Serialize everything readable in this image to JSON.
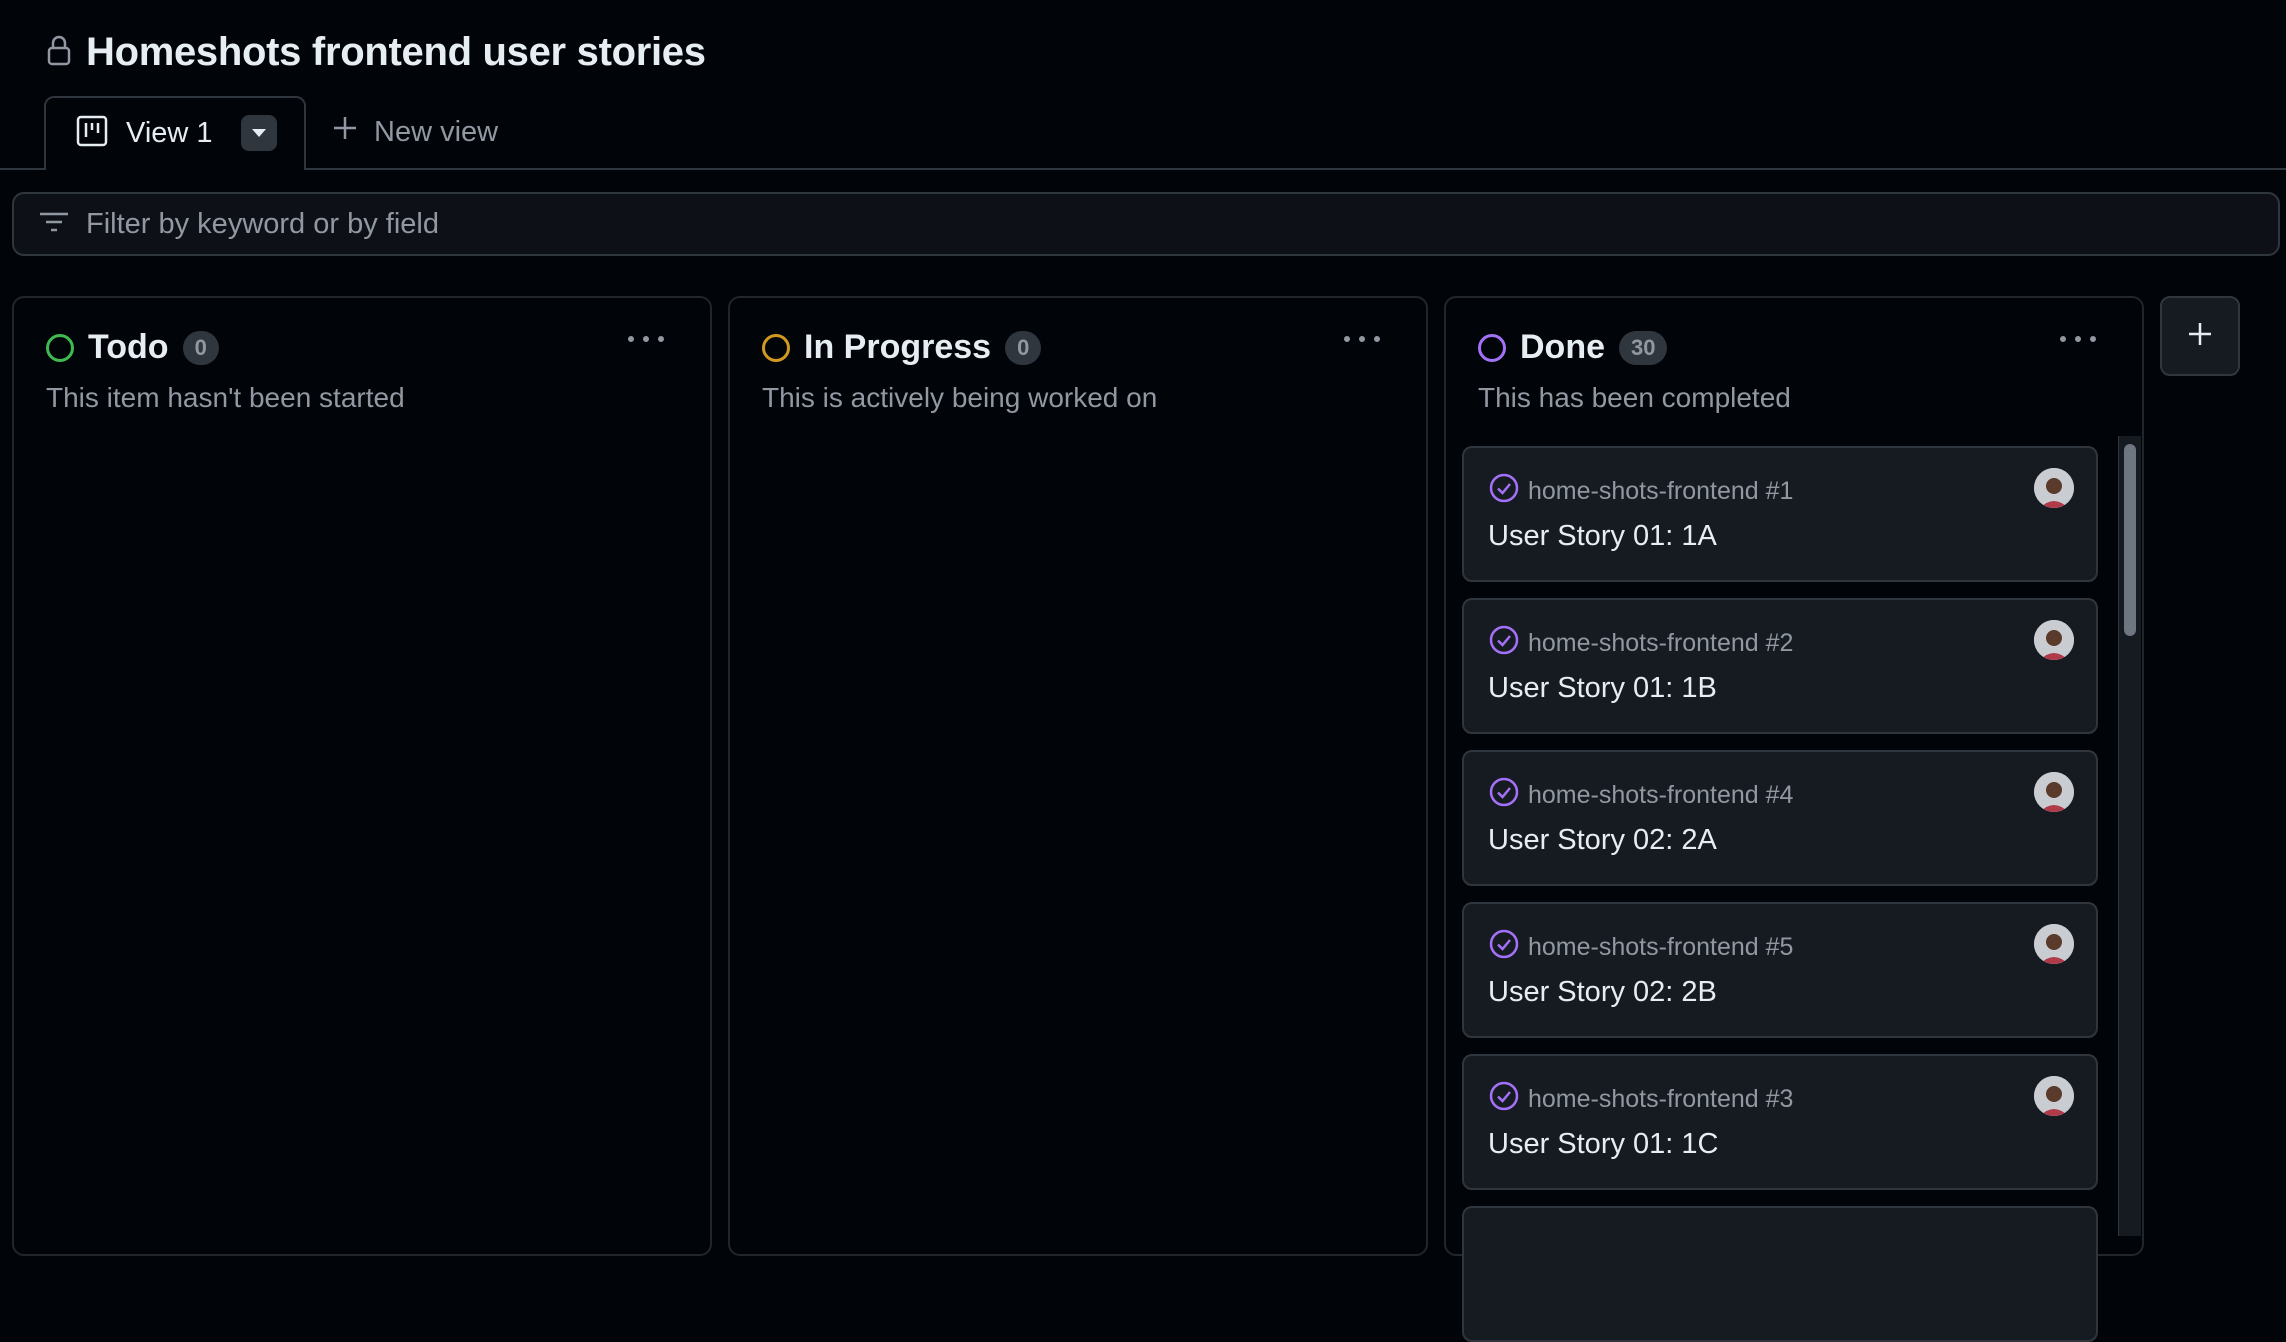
{
  "project": {
    "title": "Homeshots frontend user stories"
  },
  "tabs": {
    "active_label": "View 1",
    "new_view_label": "New view"
  },
  "filter": {
    "placeholder": "Filter by keyword or by field"
  },
  "columns": [
    {
      "name": "Todo",
      "count": "0",
      "description": "This item hasn't been started",
      "color": "#3fb950"
    },
    {
      "name": "In Progress",
      "count": "0",
      "description": "This is actively being worked on",
      "color": "#d29922"
    },
    {
      "name": "Done",
      "count": "30",
      "description": "This has been completed",
      "color": "#a371f7"
    }
  ],
  "done_cards": [
    {
      "ref": "home-shots-frontend #1",
      "title": "User Story 01: 1A"
    },
    {
      "ref": "home-shots-frontend #2",
      "title": "User Story 01: 1B"
    },
    {
      "ref": "home-shots-frontend #4",
      "title": "User Story 02: 2A"
    },
    {
      "ref": "home-shots-frontend #5",
      "title": "User Story 02: 2B"
    },
    {
      "ref": "home-shots-frontend #3",
      "title": "User Story 01: 1C"
    },
    {
      "ref": "",
      "title": ""
    }
  ],
  "colors": {
    "closed_issue": "#a371f7"
  },
  "icons": {
    "lock": "lock-icon",
    "board": "project-board-icon",
    "filter": "filter-icon",
    "add": "plus-icon",
    "more": "kebab-icon",
    "issue_closed": "issue-closed-icon"
  }
}
